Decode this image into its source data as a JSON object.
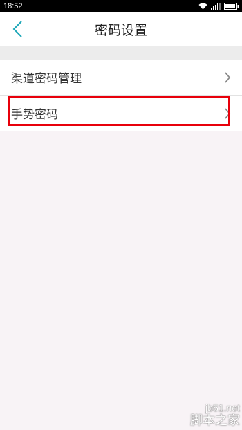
{
  "status_bar": {
    "time": "18:52"
  },
  "header": {
    "title": "密码设置",
    "back_icon": "chevron-left-icon"
  },
  "list": {
    "items": [
      {
        "label": "渠道密码管理",
        "icon": "chevron-right-icon"
      },
      {
        "label": "手势密码",
        "icon": "chevron-right-icon"
      }
    ]
  },
  "annotation": {
    "highlight_color": "#e8000b"
  },
  "watermark": {
    "domain": "jb51.net",
    "name": "脚本之家"
  },
  "colors": {
    "accent": "#1aa6b7",
    "background": "#f8f3f6"
  }
}
